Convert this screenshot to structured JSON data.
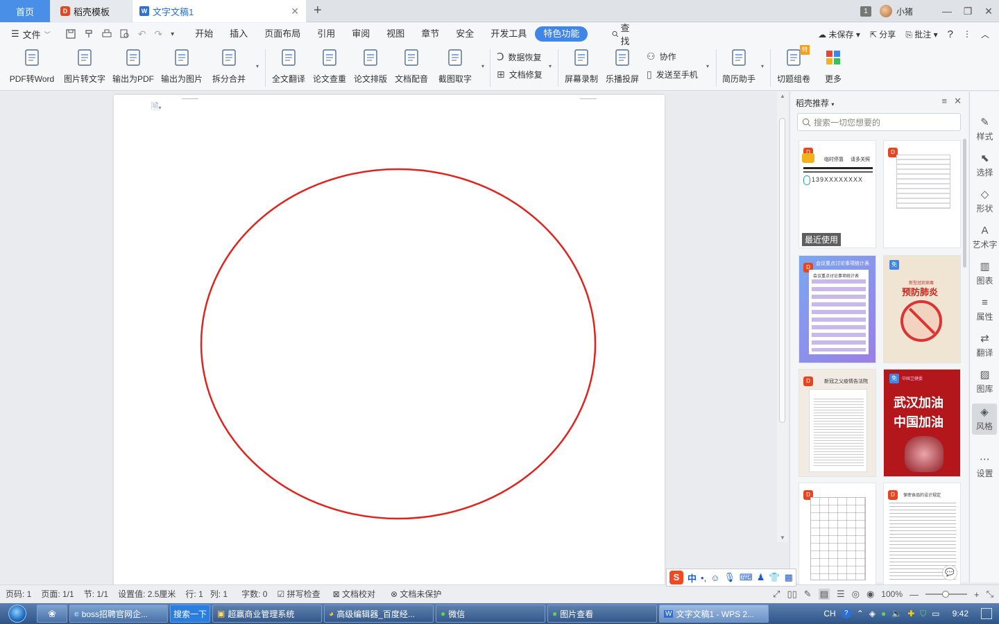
{
  "tabs": {
    "home": "首页",
    "daoke_template": "稻壳模板",
    "document": "文字文稿1",
    "add": "+"
  },
  "titlebar": {
    "window_count": "1",
    "username": "小猪",
    "minimize": "—",
    "restore": "❐",
    "close": "✕"
  },
  "menu": {
    "file": "文件",
    "items": [
      "开始",
      "插入",
      "页面布局",
      "引用",
      "审阅",
      "视图",
      "章节",
      "安全",
      "开发工具",
      "特色功能"
    ],
    "active_index": 9,
    "search": "查找",
    "unsaved": "未保存",
    "share": "分享",
    "annotate": "批注",
    "help": "?",
    "more": "⋮",
    "collapse": "︿"
  },
  "ribbon": {
    "buttons": [
      "PDF转Word",
      "图片转文字",
      "输出为PDF",
      "输出为图片",
      "拆分合并",
      "全文翻译",
      "论文查重",
      "论文排版",
      "文档配音",
      "截图取字",
      "屏幕录制",
      "乐播投屏",
      "简历助手",
      "切题组卷",
      "更多"
    ],
    "data_recovery": "数据恢复",
    "doc_repair": "文档修复",
    "collaborate": "协作",
    "send_to_phone": "发送至手机"
  },
  "panel": {
    "title": "稻壳推荐",
    "search_placeholder": "搜索一切您想要的",
    "recent_tag": "最近使用",
    "free_badge": "免",
    "card1": {
      "line1": "临时停靠",
      "line2": "请多关照",
      "phone": "139XXXXXXXX"
    },
    "card3": {
      "header": "会议重点讨论事项统计表",
      "sub": "会议重点讨论事项统计表"
    },
    "card4": {
      "header": "新型冠状病毒",
      "title": "预防肺炎"
    },
    "card5": {
      "header": "新冠之父疫情告法院"
    },
    "card6": {
      "header": "中国卫健委",
      "line1": "武汉加油",
      "line2": "中国加油"
    },
    "card8": {
      "header": "保密食品的设计规定"
    }
  },
  "strip": {
    "items": [
      "样式",
      "选择",
      "形状",
      "艺术字",
      "图表",
      "属性",
      "翻译",
      "图库",
      "风格",
      "设置"
    ],
    "active_index": 8
  },
  "statusbar": {
    "page_num": "页码: 1",
    "pages": "页面: 1/1",
    "section": "节: 1/1",
    "setting": "设置值: 2.5厘米",
    "row": "行: 1",
    "col": "列: 1",
    "words": "字数: 0",
    "spellcheck": "拼写检查",
    "proofread": "文档校对",
    "unprotected": "文档未保护",
    "zoom": "100%"
  },
  "taskbar": {
    "search_btn": "搜索一下",
    "items": [
      "boss招聘官网企...",
      "超赢商业管理系统",
      "高级编辑器_百度经...",
      "微信",
      "图片查看",
      "文字文稿1 - WPS 2..."
    ],
    "ime": "CH",
    "clock": "9:42"
  },
  "ime_bar": {
    "lang": "中",
    "punct": "•,"
  },
  "colors": {
    "accent": "#3f86e8",
    "ellipse": "#e0231c",
    "home_tab": "#4a8fe7"
  }
}
